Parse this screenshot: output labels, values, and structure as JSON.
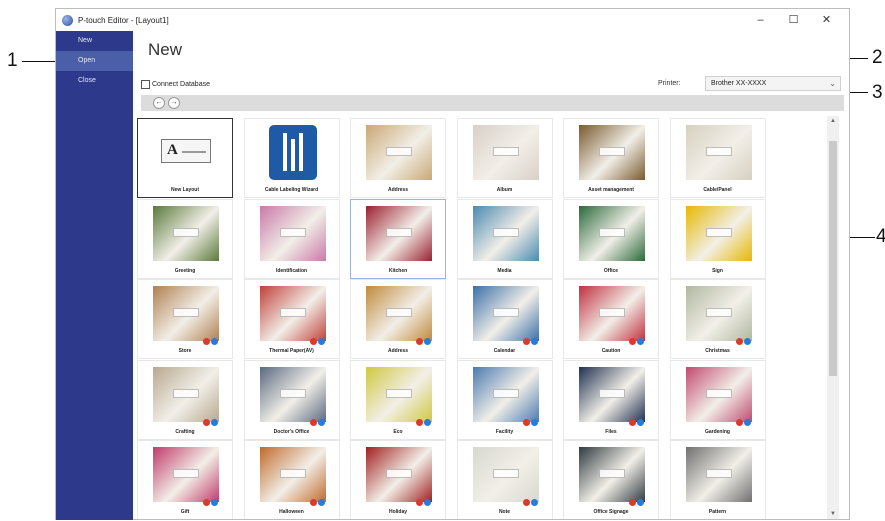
{
  "callouts": [
    "1",
    "2",
    "3",
    "4"
  ],
  "window": {
    "title": "P-touch Editor - [Layout1]",
    "controls": {
      "minimize": "–",
      "maximize": "☐",
      "close": "✕"
    }
  },
  "sidebar": {
    "items": [
      {
        "label": "New"
      },
      {
        "label": "Open"
      },
      {
        "label": "Close"
      }
    ]
  },
  "main": {
    "title": "New",
    "connect_database_label": "Connect Database",
    "printer_label": "Printer:",
    "printer_value": "Brother XX-XXXX"
  },
  "nav": {
    "back": "←",
    "forward": "→"
  },
  "templates": [
    {
      "label": "New Layout"
    },
    {
      "label": "Cable Labeling Wizard"
    },
    {
      "label": "Address"
    },
    {
      "label": "Album"
    },
    {
      "label": "Asset management"
    },
    {
      "label": "Cable/Panel"
    },
    {
      "label": "Greeting"
    },
    {
      "label": "Identification"
    },
    {
      "label": "Kitchen"
    },
    {
      "label": "Media"
    },
    {
      "label": "Office"
    },
    {
      "label": "Sign"
    },
    {
      "label": "Store"
    },
    {
      "label": "Thermal Paper(AV)"
    },
    {
      "label": "Address"
    },
    {
      "label": "Calendar"
    },
    {
      "label": "Caution"
    },
    {
      "label": "Christmas"
    },
    {
      "label": "Crafting"
    },
    {
      "label": "Doctor's Office"
    },
    {
      "label": "Eco"
    },
    {
      "label": "Facility"
    },
    {
      "label": "Files"
    },
    {
      "label": "Gardening"
    },
    {
      "label": "Gift"
    },
    {
      "label": "Halloween"
    },
    {
      "label": "Holiday"
    },
    {
      "label": "Note"
    },
    {
      "label": "Office Signage"
    },
    {
      "label": "Pattern"
    }
  ],
  "thumb_colors": [
    "#ffffff",
    "#1e5aa6",
    "#c9a875",
    "#d8d0c8",
    "#7a5a2e",
    "#d7d0c0",
    "#5a7a3a",
    "#c97aa8",
    "#9a2030",
    "#4a8ab0",
    "#2a6a3a",
    "#e6b800",
    "#b08050",
    "#c0403a",
    "#c08a3a",
    "#3a70a8",
    "#c03040",
    "#b0b8a0",
    "#b8a890",
    "#5a6a80",
    "#d0c840",
    "#4a7ab0",
    "#203050",
    "#c04a70",
    "#c03a6a",
    "#c06a2a",
    "#a02020",
    "#d8d8d0",
    "#303a40",
    "#707070"
  ],
  "icons": {
    "app": "p-touch-app-icon",
    "badge": "download-badge-icon"
  }
}
